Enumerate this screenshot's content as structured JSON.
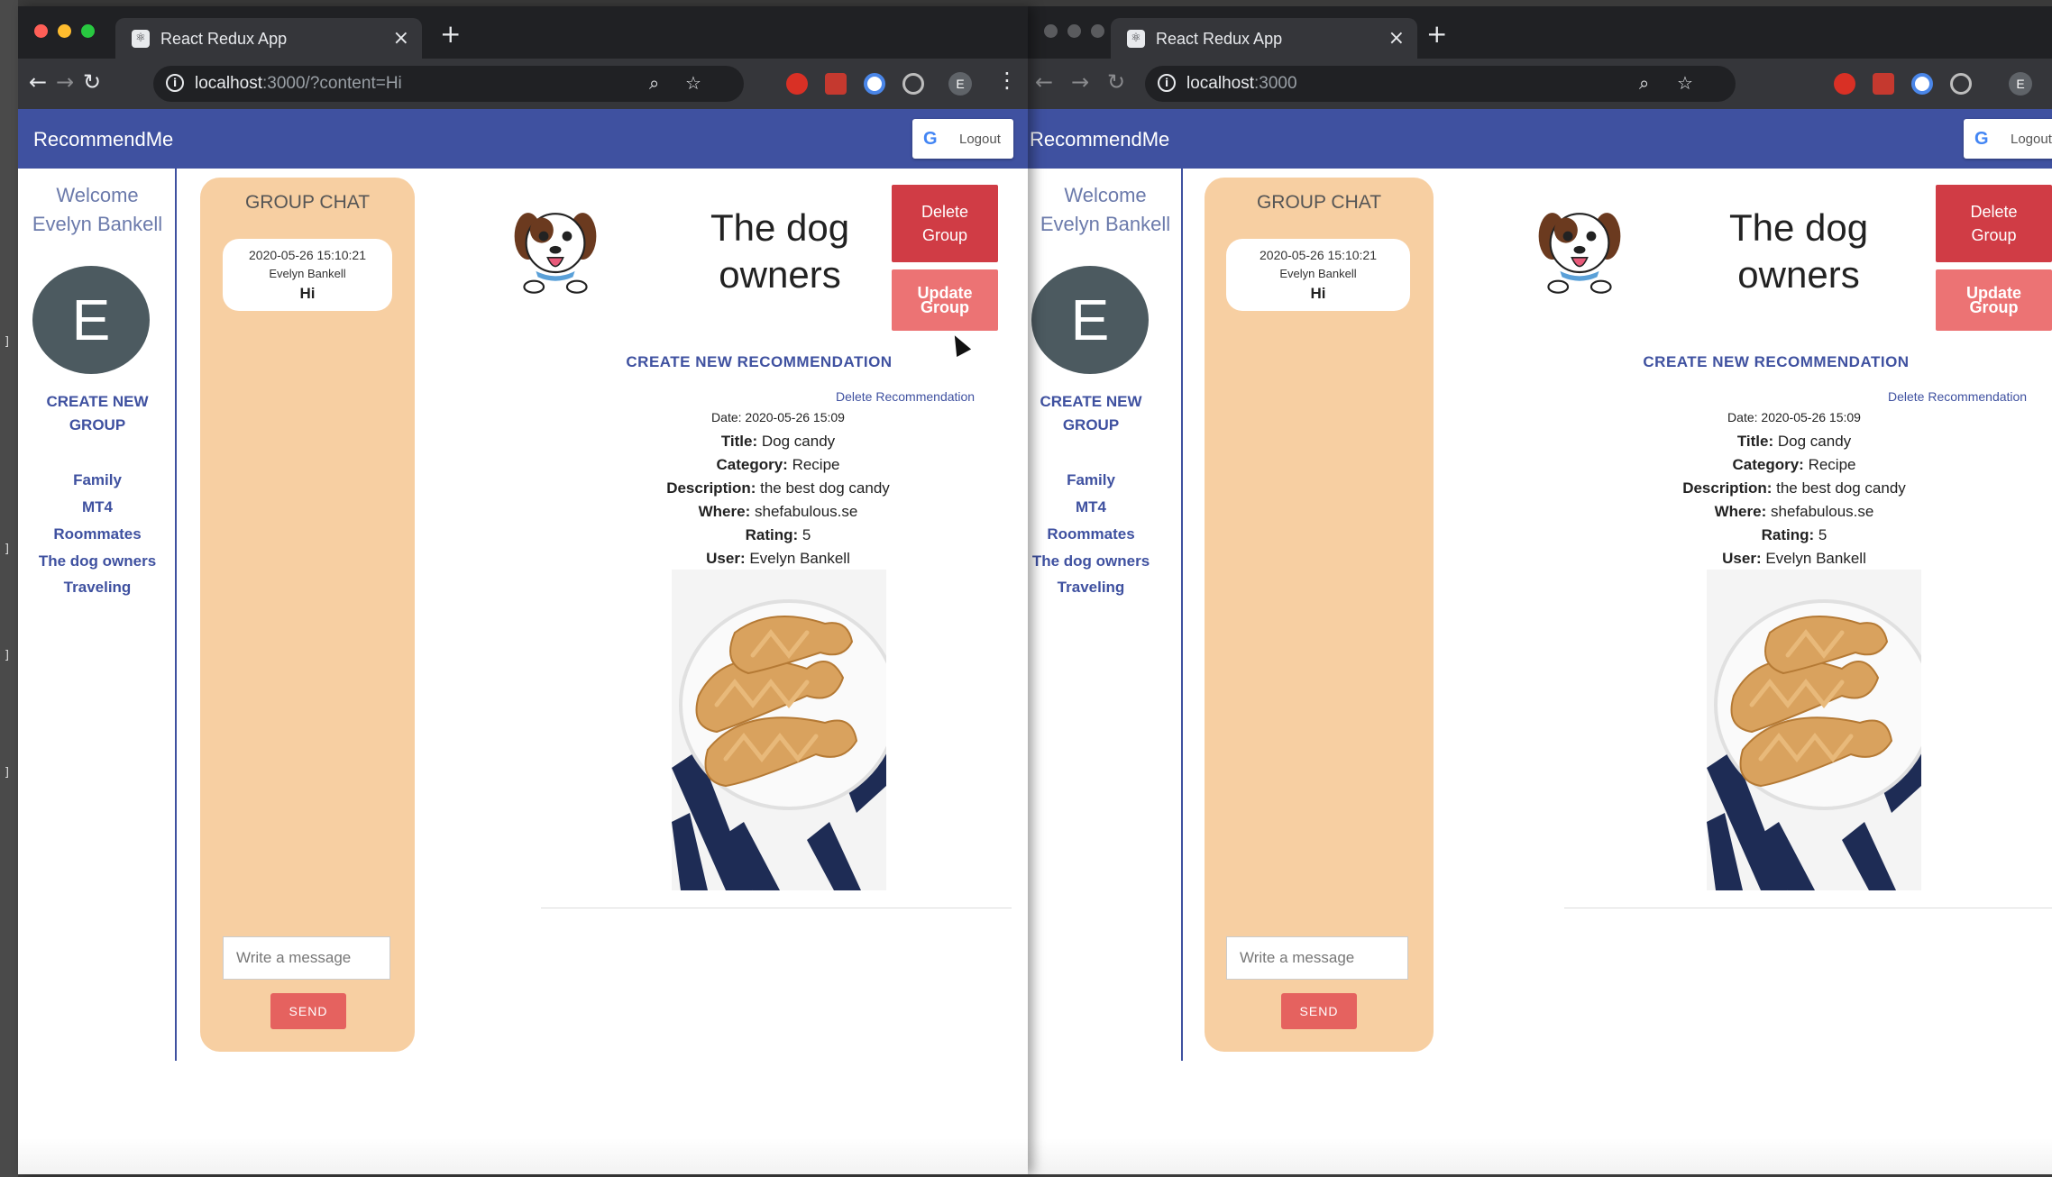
{
  "left_window": {
    "tab_title": "React Redux App",
    "url_host": "localhost",
    "url_rest": ":3000/?content=Hi",
    "profile_initial": "E"
  },
  "right_window": {
    "tab_title": "React Redux App",
    "url_host": "localhost",
    "url_rest": ":3000",
    "profile_initial": "E"
  },
  "app": {
    "brand": "RecommendMe",
    "logout_label": "Logout",
    "welcome_line1": "Welcome",
    "welcome_line2": "Evelyn Bankell",
    "avatar_initial": "E",
    "create_group_line1": "CREATE NEW",
    "create_group_line2": "GROUP",
    "groups": [
      "Family",
      "MT4",
      "Roommates",
      "The dog owners",
      "Traveling"
    ]
  },
  "chat": {
    "title": "GROUP CHAT",
    "messages": [
      {
        "time": "2020-05-26 15:10:21",
        "user": "Evelyn Bankell",
        "text": "Hi"
      }
    ],
    "input_placeholder": "Write a message",
    "send_label": "SEND"
  },
  "group": {
    "title_line1": "The dog",
    "title_line2": "owners",
    "delete_group_line1": "Delete",
    "delete_group_line2": "Group",
    "update_group_line1": "Update",
    "update_group_line2": "Group",
    "create_recommendation": "CREATE NEW RECOMMENDATION"
  },
  "recommendation": {
    "delete_label": "Delete Recommendation",
    "date_label": "Date:",
    "date": "2020-05-26 15:09",
    "title_label": "Title:",
    "title": "Dog candy",
    "category_label": "Category:",
    "category": "Recipe",
    "description_label": "Description:",
    "description": "the best dog candy",
    "where_label": "Where:",
    "where": "shefabulous.se",
    "rating_label": "Rating:",
    "rating": "5",
    "user_label": "User:",
    "user": "Evelyn Bankell"
  },
  "colors": {
    "appbar": "#3f51a0",
    "chat_panel": "#f7cfa2",
    "delete_button": "#d03c45",
    "update_button": "#ec7374",
    "send_button": "#e5625f"
  }
}
